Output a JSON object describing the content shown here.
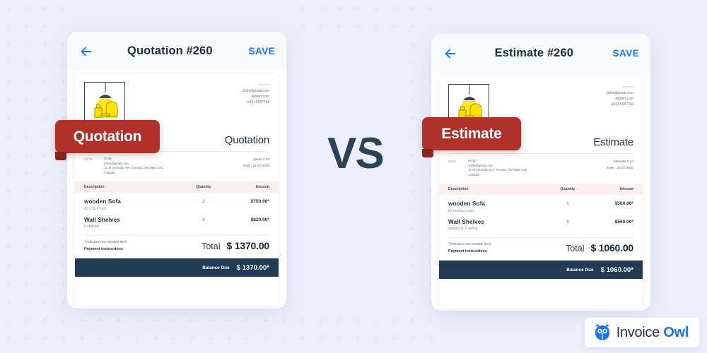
{
  "theme": {
    "bg": "#eceffb",
    "ribbon_red": "#b0302a",
    "navy": "#213b55",
    "accent_blue": "#1a73f0",
    "table_head_pink": "#fdeeee",
    "lamp_yellow": "#ffe100"
  },
  "comparison": {
    "vs_label": "VS"
  },
  "left_card": {
    "header": {
      "back_icon": "arrow-left-icon",
      "title": "Quotation #260",
      "save_label": "SAVE"
    },
    "sheet": {
      "illustration": "hanging-lamp-furniture-illustration",
      "address_label": "Address",
      "address_lines": [
        "John@gmail.com",
        "Advert.com",
        "+(41) 5587744"
      ],
      "doc_type": "Quotation",
      "bill_to_label": "Bill To",
      "bill_to": [
        "Emily",
        "emily@gmail.com",
        "31 St Germain Ave, Toronto, ON M5M 1V5,",
        "Canada"
      ],
      "meta": [
        "Quote # 24",
        "Date : 22-07-2020"
      ],
      "columns": [
        "Description",
        "Quantity",
        "Amount"
      ],
      "rows": [
        {
          "name": "wooden Sofa",
          "sub": "65 x 33.4 inch",
          "qty": "2",
          "amount": "$750.00*"
        },
        {
          "name": "Wall Shelves",
          "sub": "6 shelves",
          "qty": "2",
          "amount": "$620.00*"
        }
      ],
      "note_nontaxable": "*Indicates non-taxable item",
      "note_payment": "Payment instructions",
      "total_label": "Total",
      "total_amount": "$ 1370.00",
      "balance_label": "Balance Due",
      "balance_amount": "$ 1370.00*"
    },
    "ribbon": "Quotation"
  },
  "right_card": {
    "header": {
      "back_icon": "arrow-left-icon",
      "title": "Estimate #260",
      "save_label": "SAVE"
    },
    "sheet": {
      "illustration": "hanging-lamp-furniture-illustration",
      "address_label": "Address",
      "address_lines": [
        "John@gmail.com",
        "Advert.com",
        "+(41) 5587744"
      ],
      "doc_type": "Estimate",
      "bill_to_label": "Bill To",
      "bill_to": [
        "Emily",
        "emily@gmail.com",
        "31 St Germain Ave, Toronto, ON M5M 1V5,",
        "Canada"
      ],
      "meta": [
        "Estimate # 24",
        "Date : 22-07-2020"
      ],
      "columns": [
        "Description",
        "Quantity",
        "Amount"
      ],
      "rows": [
        {
          "name": "wooden Sofa",
          "sub": "for leaving room",
          "qty": "1",
          "amount": "$500.00*"
        },
        {
          "name": "Wall Shelves",
          "sub": "design for 2 rooms",
          "qty": "2",
          "amount": "$560.00*"
        }
      ],
      "note_nontaxable": "*Indicates non-taxable item",
      "note_payment": "Payment instructions",
      "total_label": "Total",
      "total_amount": "$ 1060.00",
      "balance_label": "Balance Due",
      "balance_amount": "$ 1060.00*"
    },
    "ribbon": "Estimate"
  },
  "logo": {
    "icon": "owl-icon",
    "word_1": "Invoice",
    "word_2": "Owl"
  }
}
